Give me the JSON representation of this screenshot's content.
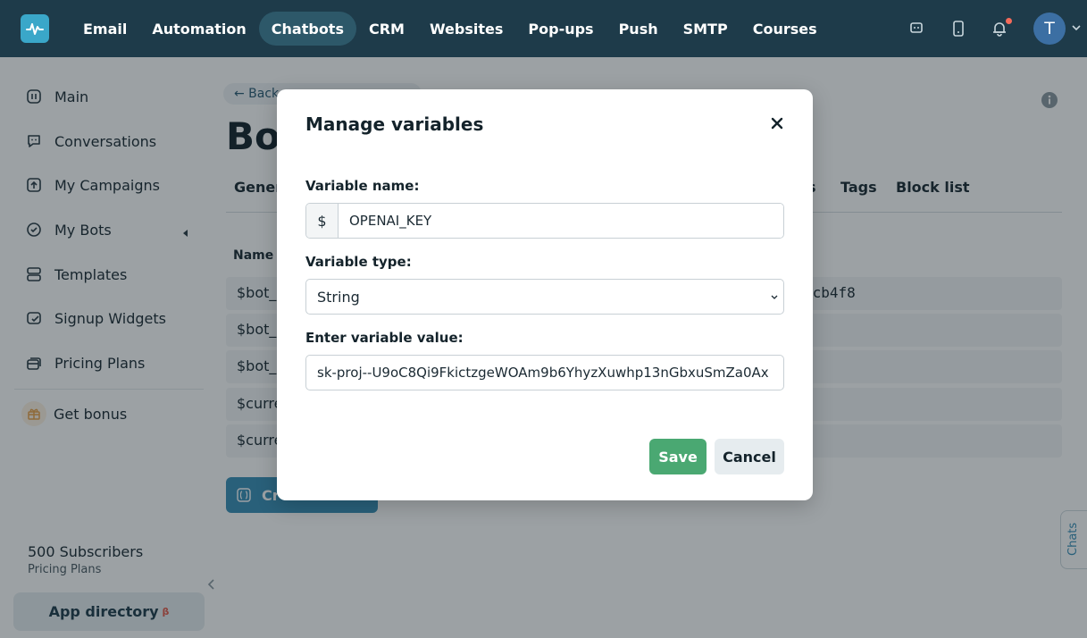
{
  "nav": {
    "items": [
      {
        "label": "Email",
        "active": false
      },
      {
        "label": "Automation",
        "active": false
      },
      {
        "label": "Chatbots",
        "active": true
      },
      {
        "label": "CRM",
        "active": false
      },
      {
        "label": "Websites",
        "active": false
      },
      {
        "label": "Pop-ups",
        "active": false
      },
      {
        "label": "Push",
        "active": false
      },
      {
        "label": "SMTP",
        "active": false
      },
      {
        "label": "Courses",
        "active": false
      }
    ],
    "avatar_letter": "T"
  },
  "sidebar": {
    "items": [
      {
        "label": "Main",
        "icon": "dashboard-icon"
      },
      {
        "label": "Conversations",
        "icon": "chat-icon"
      },
      {
        "label": "My Campaigns",
        "icon": "campaign-icon"
      },
      {
        "label": "My Bots",
        "icon": "bot-icon"
      },
      {
        "label": "Templates",
        "icon": "templates-icon"
      },
      {
        "label": "Signup Widgets",
        "icon": "widget-icon"
      },
      {
        "label": "Pricing Plans",
        "icon": "pricing-icon"
      }
    ],
    "bonus_label": "Get bonus",
    "subscribers": "500 Subscribers",
    "plan": "Pricing Plans",
    "app_directory": "App directory",
    "app_directory_badge": "β"
  },
  "page": {
    "back": "← Back",
    "title": "Bot",
    "tabs": [
      "Genera",
      "s",
      "Tags",
      "Block list"
    ],
    "column_name": "Name",
    "rows": [
      {
        "name": "$bot_i",
        "value": "0cb4f8"
      },
      {
        "name": "$bot_r",
        "value": ":"
      },
      {
        "name": "$bot_(",
        "value": ":"
      },
      {
        "name": "$curre",
        "value": ""
      },
      {
        "name": "$curre",
        "value": ""
      }
    ],
    "create_button": "Cr",
    "chats_tab": "Chats"
  },
  "modal": {
    "title": "Manage variables",
    "name_label": "Variable name:",
    "name_prefix": "$",
    "name_value": "OPENAI_KEY",
    "type_label": "Variable type:",
    "type_value": "String",
    "value_label": "Enter variable value:",
    "value_value": "sk-proj--U9oC8Qi9FkictzgeWOAm9b6YhyzXuwhp13nGbxuSmZa0Ax",
    "save_label": "Save",
    "cancel_label": "Cancel"
  },
  "colors": {
    "topbar": "#1e3b4a",
    "accent": "#3aa7c9",
    "save": "#4aa872",
    "notification": "#f46a5a"
  }
}
